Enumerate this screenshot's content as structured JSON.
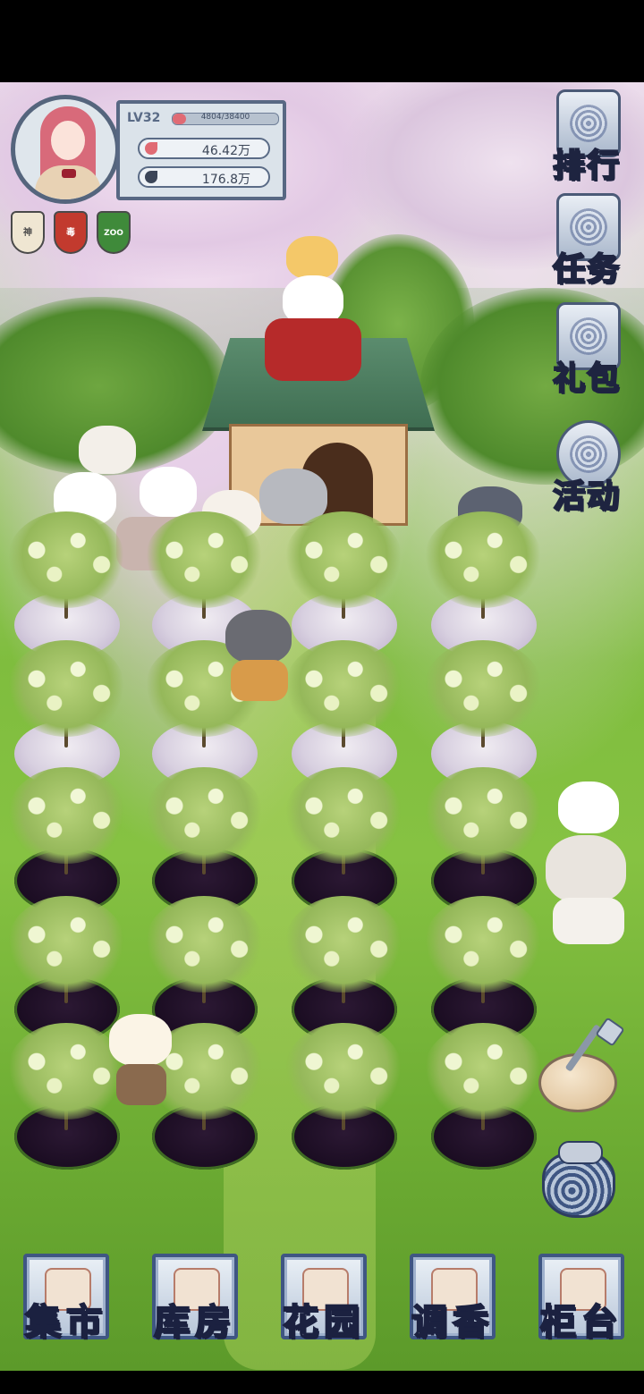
{
  "player": {
    "level": "LV32",
    "xp": "4804/38400",
    "xp_fraction": 0.125,
    "petals": "46.42万",
    "leaves": "176.8万"
  },
  "badges": [
    {
      "label": "神",
      "color": "#efe6d2"
    },
    {
      "label": "毒",
      "color": "#c23a2e"
    },
    {
      "label": "ZOO",
      "color": "#3f8a3a"
    }
  ],
  "side_menu": [
    {
      "label": "排行",
      "icon": "ranking-icon"
    },
    {
      "label": "任务",
      "icon": "task-icon"
    },
    {
      "label": "礼包",
      "icon": "gift-icon"
    },
    {
      "label": "活动",
      "icon": "event-icon"
    }
  ],
  "garden": {
    "rows": [
      [
        "light",
        "light",
        "light",
        "light"
      ],
      [
        "light",
        "light",
        "light",
        "light"
      ],
      [
        "dark",
        "dark",
        "dark",
        "dark"
      ],
      [
        "dark",
        "dark",
        "dark",
        "dark"
      ],
      [
        "dark",
        "dark",
        "dark",
        "dark"
      ]
    ]
  },
  "tools": [
    {
      "icon": "shovel-icon"
    },
    {
      "icon": "seed-bag-icon"
    }
  ],
  "bottom_nav": [
    {
      "label": "集市",
      "icon": "market-icon"
    },
    {
      "label": "库房",
      "icon": "warehouse-icon"
    },
    {
      "label": "花园",
      "icon": "rose-icon"
    },
    {
      "label": "调香",
      "icon": "perfume-icon"
    },
    {
      "label": "柜台",
      "icon": "counter-icon"
    }
  ],
  "colors": {
    "accent_border": "#4b5a77",
    "petal_red": "#e06b74",
    "leaf_dark": "#3c4658"
  }
}
